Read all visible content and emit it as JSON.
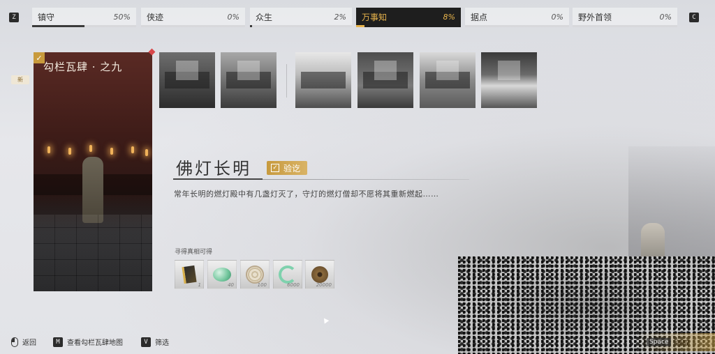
{
  "keys": {
    "prev": "Z",
    "next": "C"
  },
  "tabs": [
    {
      "label": "镇守",
      "pct": "50%",
      "progress": 0.5,
      "active": false
    },
    {
      "label": "侠迹",
      "pct": "0%",
      "progress": 0.0,
      "active": false
    },
    {
      "label": "众生",
      "pct": "2%",
      "progress": 0.02,
      "active": false
    },
    {
      "label": "万事知",
      "pct": "8%",
      "progress": 0.08,
      "active": true
    },
    {
      "label": "据点",
      "pct": "0%",
      "progress": 0.0,
      "active": false
    },
    {
      "label": "野外首领",
      "pct": "0%",
      "progress": 0.0,
      "active": false
    }
  ],
  "card": {
    "title": "勾栏瓦肆 · 之九",
    "checked": true,
    "new_tag": "新"
  },
  "detail": {
    "title": "佛灯长明",
    "status": "验讫",
    "description": "常年长明的燃灯殿中有几盏灯灭了，守灯的燃灯僧却不愿将其重新燃起……"
  },
  "rewards": {
    "label": "寻得真相可得",
    "items": [
      {
        "icon": "book-icon",
        "count": "1"
      },
      {
        "icon": "jade-icon",
        "count": "40"
      },
      {
        "icon": "coin-icon",
        "count": "100"
      },
      {
        "icon": "swirl-icon",
        "count": "6000"
      },
      {
        "icon": "bronze-coin-icon",
        "count": "20000"
      }
    ]
  },
  "claim": {
    "key": "Space",
    "label": "领取"
  },
  "hints": {
    "back": "返回",
    "map_key": "M",
    "map": "查看勾栏瓦肆地图",
    "filter_key": "V",
    "filter": "筛选"
  },
  "colors": {
    "accent": "#e8b44c",
    "tab_active_bg": "#1e1e1e",
    "badge": "#c79a3e",
    "dot": "#d8484b"
  }
}
